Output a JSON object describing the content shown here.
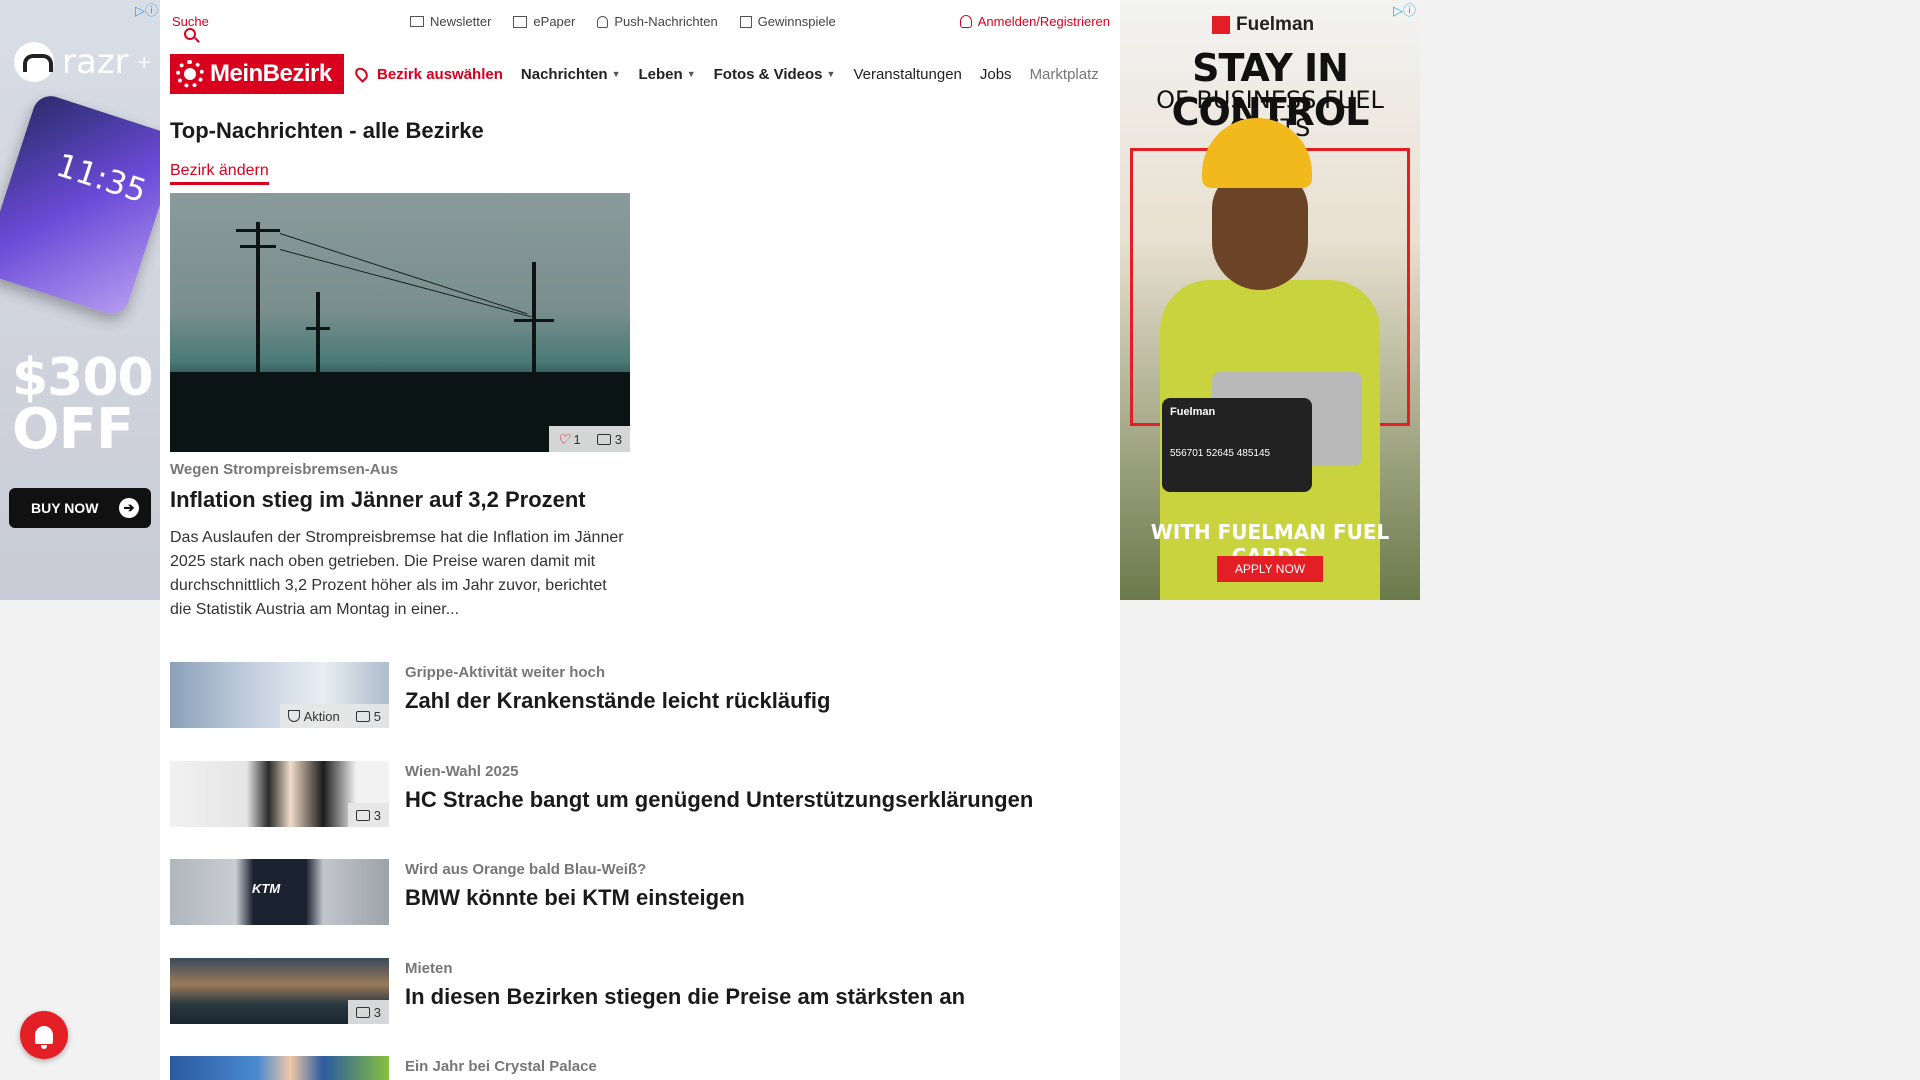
{
  "topbar": {
    "search": "Suche",
    "links": [
      "Newsletter",
      "ePaper",
      "Push-Nachrichten",
      "Gewinnspiele"
    ],
    "login": "Anmelden/Registrieren"
  },
  "nav": {
    "logo": "MeinBezirk",
    "select_district": "Bezirk auswählen",
    "items": [
      "Nachrichten",
      "Leben",
      "Fotos & Videos",
      "Veranstaltungen",
      "Jobs",
      "Marktplatz"
    ]
  },
  "section": {
    "title": "Top-Nachrichten - alle Bezirke",
    "change": "Bezirk ändern"
  },
  "hero": {
    "likes": "1",
    "images": "3",
    "kicker": "Wegen Strompreisbremsen-Aus",
    "title": "Inflation stieg im Jänner auf 3,2 Prozent",
    "text": "Das Auslaufen der Strompreisbremse hat die Inflation im Jänner 2025 stark nach oben getrieben. Die Preise waren damit mit durchschnittlich 3,2 Prozent höher als im Jahr zuvor, berichtet die Statistik Austria am Montag in einer..."
  },
  "articles": [
    {
      "kicker": "Grippe-Aktivität weiter hoch",
      "title": "Zahl der Krankenstände leicht rückläufig",
      "action": "Aktion",
      "images": "5"
    },
    {
      "kicker": "Wien-Wahl 2025",
      "title": "HC Strache bangt um genügend Unterstützungserklärungen",
      "images": "3"
    },
    {
      "kicker": "Wird aus Orange bald Blau-Weiß?",
      "title": "BMW könnte bei KTM einsteigen",
      "logo_text": "KTM"
    },
    {
      "kicker": "Mieten",
      "title": "In diesen Bezirken stiegen die Preise am stärksten an",
      "images": "3"
    },
    {
      "kicker": "Ein Jahr bei Crystal Palace",
      "title": ""
    }
  ],
  "ad_left": {
    "brand": "razr",
    "brand_sup": "+",
    "time": "11:35",
    "offer_line1": "$300",
    "offer_line2": "OFF",
    "cta": "BUY NOW"
  },
  "ad_right": {
    "brand": "Fuelman",
    "headline": "STAY IN CONTROL",
    "subhead": "OF BUSINESS FUEL COSTS",
    "card_brand": "Fuelman",
    "card_number": "556701 52645 485145",
    "tagline": "WITH FUELMAN FUEL CARDS",
    "cta": "APPLY NOW"
  },
  "colors": {
    "accent": "#d8001c",
    "fuelman_red": "#e31e24"
  }
}
